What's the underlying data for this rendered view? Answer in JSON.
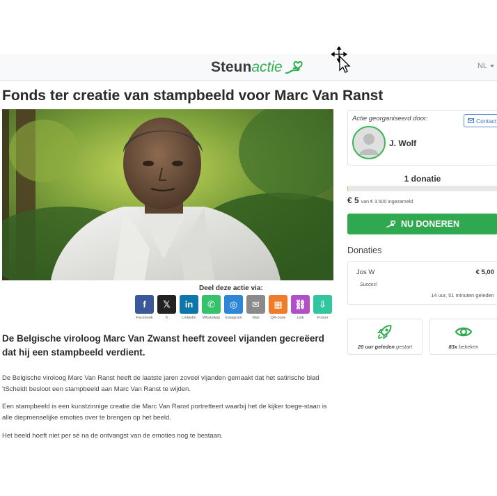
{
  "brand": {
    "part1": "Steun",
    "part2": "actie",
    "accent": "#2fae4e"
  },
  "header": {
    "language": "NL"
  },
  "campaign": {
    "title": "Fonds ter creatie van stampbeeld voor Marc Van Ranst",
    "lead": "De Belgische viroloog Marc Van Zwanst heeft zoveel vijanden gecreëerd dat hij een stampbeeld verdient.",
    "paragraphs": [
      "De Belgische viroloog Marc Van Ranst heeft de laatste jaren zoveel vijanden gemaakt dat het satirische blad 'tScheldt besloot een stampbeeld aan Marc Van Ranst te wijden.",
      "Een stampbeeld is een kunstzinnige creatie die Marc Van Ranst portretteert waarbij het de kijker toege-staan is alle diepmenselijke emoties over te brengen op het beeld.",
      "Het beeld hoeft niet per sé na de ontvangst van de emoties nog te bestaan."
    ]
  },
  "share": {
    "label": "Deel deze actie via:",
    "items": [
      {
        "name": "facebook",
        "caption": "Facebook",
        "glyph": "f",
        "color": "#3b5998"
      },
      {
        "name": "x",
        "caption": "X",
        "glyph": "𝕏",
        "color": "#222222"
      },
      {
        "name": "linkedin",
        "caption": "Linkedin",
        "glyph": "in",
        "color": "#0e76a8"
      },
      {
        "name": "whatsapp",
        "caption": "WhatsApp",
        "glyph": "✆",
        "color": "#35c26a"
      },
      {
        "name": "instagram",
        "caption": "Instagram",
        "glyph": "◎",
        "color": "#2e86d6"
      },
      {
        "name": "mail",
        "caption": "Mail",
        "glyph": "✉",
        "color": "#8a8a8a"
      },
      {
        "name": "qr-code",
        "caption": "QR-code",
        "glyph": "▦",
        "color": "#f07b2a"
      },
      {
        "name": "link",
        "caption": "Link",
        "glyph": "⛓",
        "color": "#b14fc9"
      },
      {
        "name": "poster",
        "caption": "Poster",
        "glyph": "⇩",
        "color": "#32c6a0"
      }
    ]
  },
  "organizer": {
    "label": "Actie georganiseerd door:",
    "contact_label": "Contact",
    "name": "J. Wolf"
  },
  "funding": {
    "donations_count_label": "1 donatie",
    "raised_amount": "€ 5",
    "raised_suffix": "van € 3.500 ingezameld",
    "progress_fraction": 0.0014,
    "donate_label": "NU DONEREN"
  },
  "donations": {
    "title": "Donaties",
    "items": [
      {
        "name": "Jos W",
        "amount": "€ 5,00",
        "message": "Succes!",
        "time": "14 uur, 51 minuten geleden"
      }
    ]
  },
  "stats": {
    "started_value": "20 uur geleden",
    "started_suffix": "gestart",
    "views_value": "83x",
    "views_suffix": "bekeken"
  }
}
